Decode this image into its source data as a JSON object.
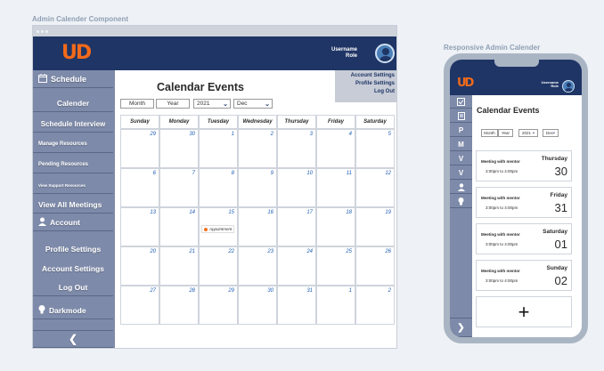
{
  "captions": {
    "desktop": "Admin Calender Component",
    "mobile": "Responsive Admin Calender"
  },
  "brand": {
    "logo": "UD",
    "accent": "#f26a1b",
    "navy": "#1f3566",
    "sidebar": "#7d8aa9"
  },
  "header": {
    "username": "Username",
    "role": "Role"
  },
  "sidebar": {
    "schedule": "Schedule",
    "calender": "Calender",
    "schedule_interview": "Schedule Interview",
    "manage_resources": "Manage Resources",
    "pending_resources": "Pending Resources",
    "view_support_resources": "View Support Resources",
    "view_all_meetings": "View All Meetings",
    "account": "Account",
    "profile_settings": "Profile Settings",
    "account_settings": "Account Settings",
    "log_out": "Log Out",
    "darkmode": "Darkmode"
  },
  "account_menu": [
    "Account Settings",
    "Profile Settings",
    "Log Out"
  ],
  "main": {
    "title": "Calendar Events",
    "controls": {
      "month": "Month",
      "year": "Year",
      "year_value": "2021",
      "month_value": "Dec"
    }
  },
  "calendar": {
    "days": [
      "Sunday",
      "Monday",
      "Tuesday",
      "Wednesday",
      "Thursday",
      "Friday",
      "Saturday"
    ],
    "weeks": [
      [
        "29",
        "30",
        "1",
        "2",
        "3",
        "4",
        "5"
      ],
      [
        "6",
        "7",
        "8",
        "9",
        "10",
        "11",
        "12"
      ],
      [
        "13",
        "14",
        "15",
        "16",
        "17",
        "18",
        "19"
      ],
      [
        "20",
        "21",
        "22",
        "23",
        "24",
        "25",
        "26"
      ],
      [
        "27",
        "28",
        "29",
        "30",
        "31",
        "1",
        "2"
      ]
    ],
    "event": {
      "label": "Appointment"
    }
  },
  "mobile": {
    "title": "Calendar Events",
    "controls": {
      "month": "Month",
      "year": "Year",
      "year_value": "2021",
      "month_value": "Dec"
    },
    "side_letters": [
      "P",
      "M",
      "V",
      "V"
    ],
    "meetings": [
      {
        "title": "Meeting with mentor",
        "time": "3:00pm to 4:00pm",
        "day": "Thursday",
        "date": "30"
      },
      {
        "title": "Meeting with mentor",
        "time": "3:00pm to 4:00pm",
        "day": "Friday",
        "date": "31"
      },
      {
        "title": "Meeting with mentor",
        "time": "3:00pm to 4:00pm",
        "day": "Saturday",
        "date": "01"
      },
      {
        "title": "Meeting with mentor",
        "time": "3:00pm to 4:00pm",
        "day": "Sunday",
        "date": "02"
      }
    ],
    "add_label": "+"
  }
}
